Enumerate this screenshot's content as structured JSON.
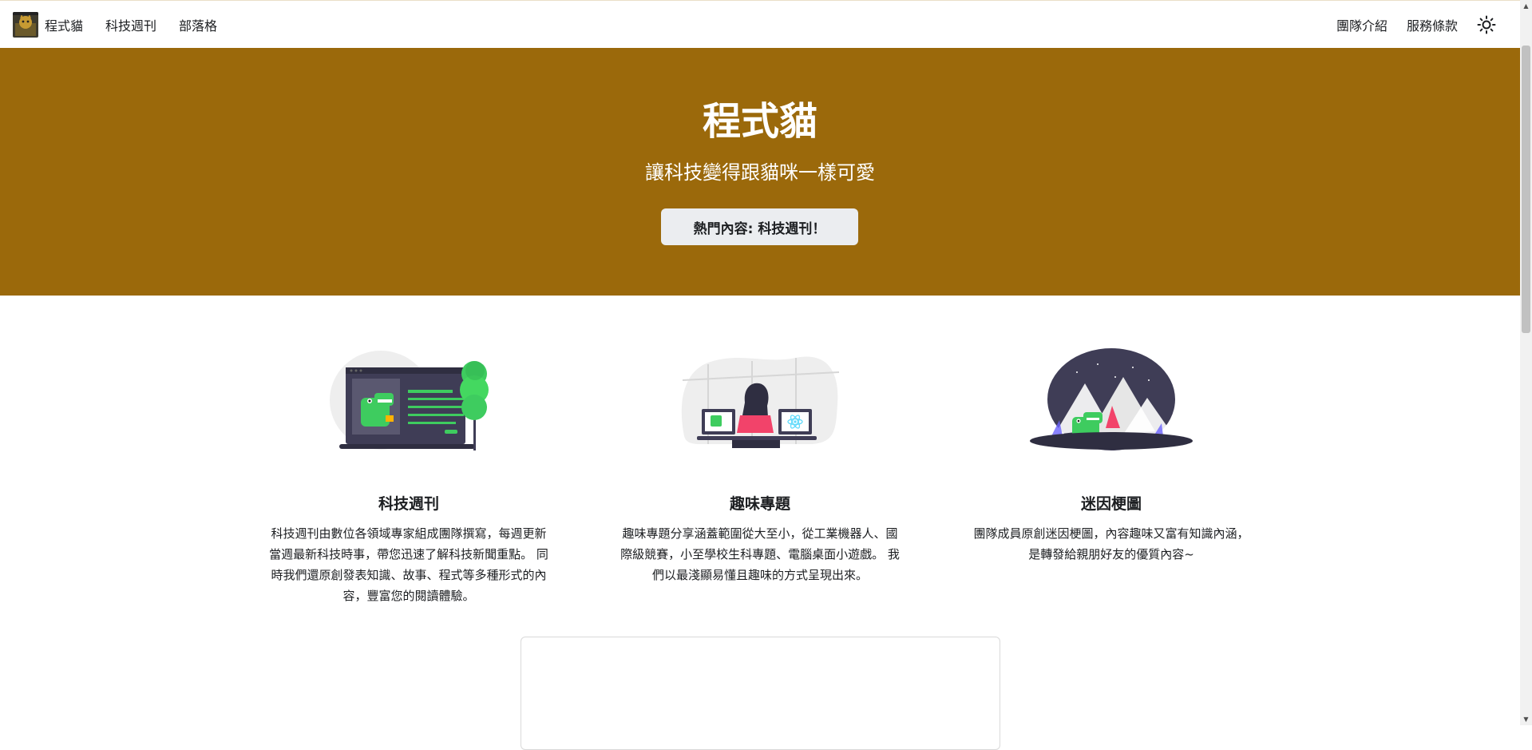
{
  "nav": {
    "brand": "程式貓",
    "left_links": [
      "科技週刊",
      "部落格"
    ],
    "right_links": [
      "團隊介紹",
      "服務條款"
    ],
    "theme_toggle_icon": "sun-icon"
  },
  "hero": {
    "title": "程式貓",
    "subtitle": "讓科技變得跟貓咪一樣可愛",
    "button_label": "熱門內容: 科技週刊！",
    "background_color": "#9b690b"
  },
  "features": [
    {
      "title": "科技週刊",
      "illustration": "laptop-dino-illustration",
      "description_lines": [
        "科技週刊由數位各領域專家組成團隊撰寫，每週更新",
        "當週最新科技時事，帶您迅速了解科技新聞重點。 同",
        "時我們還原創發表知識、故事、程式等多種形式的內",
        "容，豐富您的閱讀體驗。"
      ]
    },
    {
      "title": "趣味專題",
      "illustration": "developer-desk-illustration",
      "description_lines": [
        "趣味專題分享涵蓋範圍從大至小，從工業機器人、國",
        "際級競賽，小至學校生科專題、電腦桌面小遊戲。 我",
        "們以最淺顯易懂且趣味的方式呈現出來。"
      ]
    },
    {
      "title": "迷因梗圖",
      "illustration": "night-mountains-illustration",
      "description_lines": [
        "團隊成員原創迷因梗圖，內容趣味又富有知識內涵，",
        "是轉發給親朋好友的優質內容~"
      ]
    }
  ]
}
